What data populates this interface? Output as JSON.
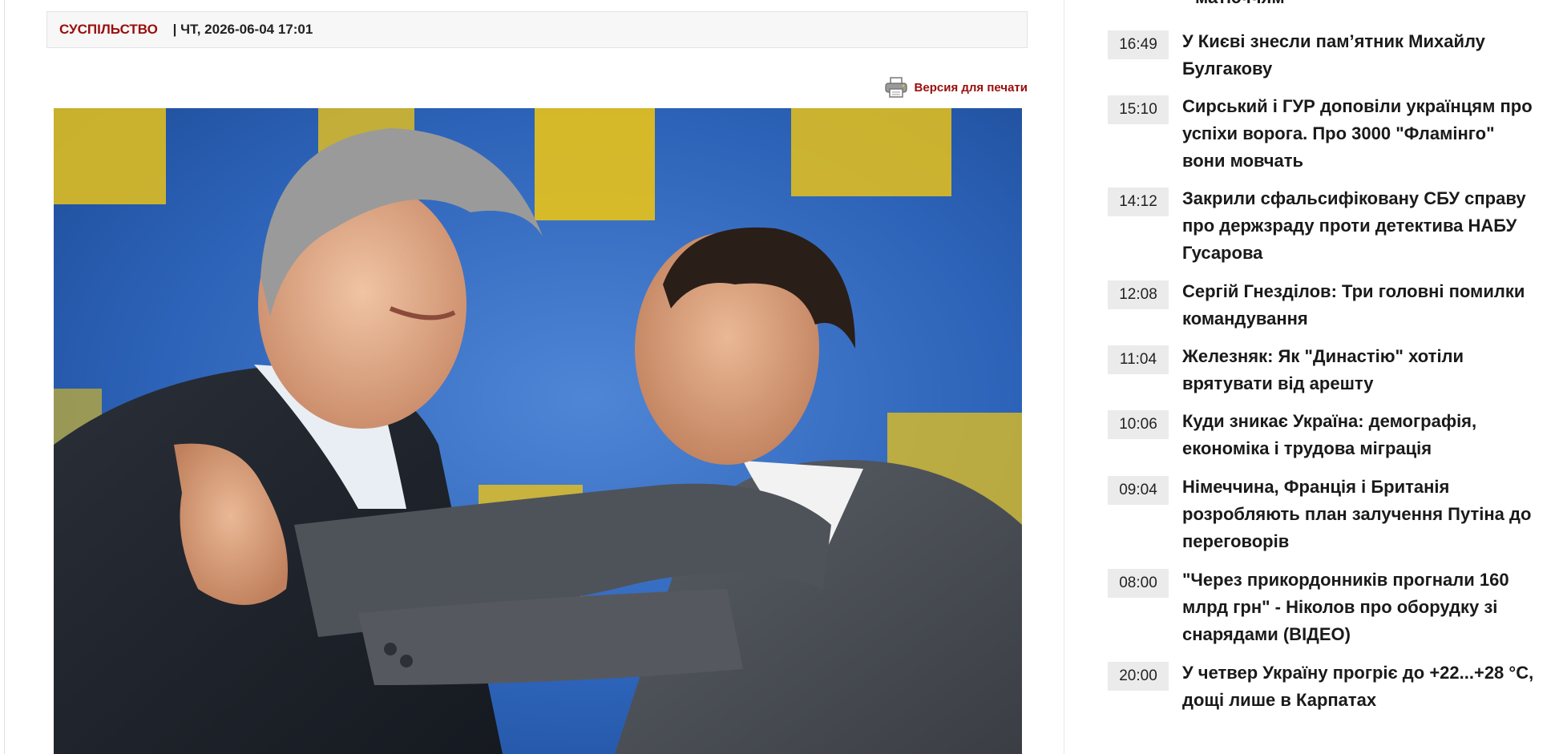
{
  "article": {
    "category": "Суспільство",
    "separator": " | ",
    "date": "ЧТ, 2026-06-04 17:01",
    "print_label": "Версия для печати",
    "image": {
      "description_icon": "photo"
    }
  },
  "news_feed": {
    "partial_top_title": "матюччям",
    "items": [
      {
        "time": "16:49",
        "title": "У Києві знесли пам’ятник Михайлу Булгакову"
      },
      {
        "time": "15:10",
        "title": "Сирський і ГУР доповіли українцям про успіхи ворога. Про 3000 \"Фламінго\" вони мовчать"
      },
      {
        "time": "14:12",
        "title": "Закрили сфальсифіковану СБУ справу про держзраду проти детектива НАБУ Гусарова"
      },
      {
        "time": "12:08",
        "title": "Сергій Гнезділов: Три головні помилки командування"
      },
      {
        "time": "11:04",
        "title": "Железняк: Як \"Династію\" хотіли врятувати від арешту"
      },
      {
        "time": "10:06",
        "title": "Куди зникає Україна: демографія, економіка і трудова міграція"
      },
      {
        "time": "09:04",
        "title": "Німеччина, Франція і Британія розробляють план залучення Путіна до переговорів"
      },
      {
        "time": "08:00",
        "title": "\"Через прикордонників прогнали 160 млрд грн\" - Ніколов про оборудку зі снарядами (ВІДЕО)"
      },
      {
        "time": "20:00",
        "title": "У четвер Україну прогріє до +22...+28 °C, дощі лише в Карпатах"
      }
    ]
  },
  "colors": {
    "accent": "#9a0d0d",
    "time_bg": "#ebebeb",
    "meta_bg": "#f7f7f7",
    "photo_bg_blue": "#2a63b8",
    "photo_bg_yellow": "#e8c21a"
  }
}
